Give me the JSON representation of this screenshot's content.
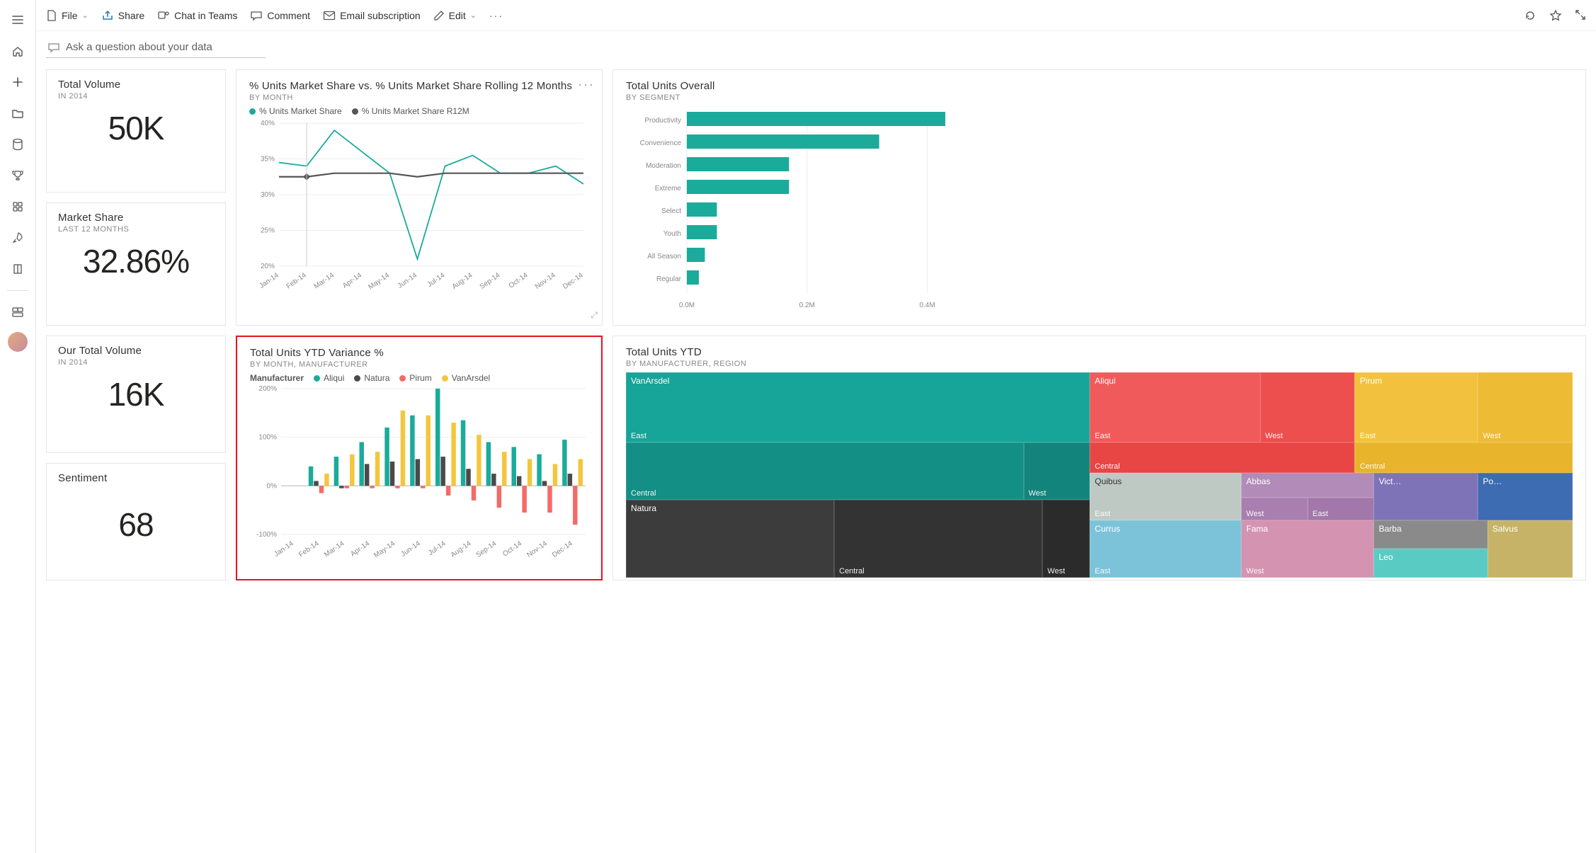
{
  "leftrail": {
    "items": [
      "menu",
      "home",
      "add",
      "folder",
      "data",
      "trophy",
      "apps",
      "rocket",
      "book"
    ],
    "more": "more"
  },
  "topbar": {
    "file": "File",
    "share": "Share",
    "chat": "Chat in Teams",
    "comment": "Comment",
    "email": "Email subscription",
    "edit": "Edit",
    "more": "···"
  },
  "qa": {
    "placeholder": "Ask a question about your data"
  },
  "kpi": {
    "totalvol": {
      "title": "Total Volume",
      "sub": "IN 2014",
      "value": "50K"
    },
    "mshare": {
      "title": "Market Share",
      "sub": "LAST 12 MONTHS",
      "value": "32.86%"
    },
    "ourvol": {
      "title": "Our Total Volume",
      "sub": "IN 2014",
      "value": "16K"
    },
    "sentiment": {
      "title": "Sentiment",
      "sub": "",
      "value": "68"
    }
  },
  "lineCard": {
    "title": "% Units Market Share vs. % Units Market Share Rolling 12 Months",
    "sub": "BY MONTH",
    "legend": [
      "% Units Market Share",
      "% Units Market Share R12M"
    ]
  },
  "segCard": {
    "title": "Total Units Overall",
    "sub": "BY SEGMENT"
  },
  "varCard": {
    "title": "Total Units YTD Variance %",
    "sub": "BY MONTH, MANUFACTURER",
    "legendLabel": "Manufacturer",
    "legend": [
      "Aliqui",
      "Natura",
      "Pirum",
      "VanArsdel"
    ]
  },
  "tmCard": {
    "title": "Total Units YTD",
    "sub": "BY MANUFACTURER, REGION"
  },
  "chart_data": [
    {
      "type": "line",
      "title": "% Units Market Share vs. % Units Market Share Rolling 12 Months",
      "categories": [
        "Jan-14",
        "Feb-14",
        "Mar-14",
        "Apr-14",
        "May-14",
        "Jun-14",
        "Jul-14",
        "Aug-14",
        "Sep-14",
        "Oct-14",
        "Nov-14",
        "Dec-14"
      ],
      "series": [
        {
          "name": "% Units Market Share",
          "color": "#1aab9b",
          "values": [
            34.5,
            34,
            39,
            36,
            33,
            21,
            34,
            35.5,
            33,
            33,
            34,
            31.5
          ]
        },
        {
          "name": "% Units Market Share R12M",
          "color": "#555555",
          "values": [
            32.5,
            32.5,
            33,
            33,
            33,
            32.5,
            33,
            33,
            33,
            33,
            33,
            33
          ]
        }
      ],
      "ylabel": "",
      "ylim": [
        20,
        40
      ],
      "yTicks": [
        20,
        25,
        30,
        35,
        40
      ]
    },
    {
      "type": "bar",
      "orientation": "horizontal",
      "title": "Total Units Overall by Segment",
      "categories": [
        "Productivity",
        "Convenience",
        "Moderation",
        "Extreme",
        "Select",
        "Youth",
        "All Season",
        "Regular"
      ],
      "values": [
        0.43,
        0.32,
        0.17,
        0.17,
        0.05,
        0.05,
        0.03,
        0.02
      ],
      "xlabel": "",
      "xlim": [
        0,
        0.45
      ],
      "xTicks": [
        0.0,
        0.2,
        0.4
      ],
      "xTickLabels": [
        "0.0M",
        "0.2M",
        "0.4M"
      ],
      "color": "#1aab9b"
    },
    {
      "type": "bar",
      "title": "Total Units YTD Variance % by Month, Manufacturer",
      "categories": [
        "Jan-14",
        "Feb-14",
        "Mar-14",
        "Apr-14",
        "May-14",
        "Jun-14",
        "Jul-14",
        "Aug-14",
        "Sep-14",
        "Oct-14",
        "Nov-14",
        "Dec-14"
      ],
      "series": [
        {
          "name": "Aliqui",
          "color": "#1aab9b",
          "values": [
            null,
            40,
            60,
            90,
            120,
            145,
            200,
            135,
            90,
            80,
            65,
            95
          ]
        },
        {
          "name": "Natura",
          "color": "#4a4a4a",
          "values": [
            null,
            10,
            -5,
            45,
            50,
            55,
            60,
            35,
            25,
            20,
            10,
            25
          ]
        },
        {
          "name": "Pirum",
          "color": "#f46a6a",
          "values": [
            null,
            -15,
            -5,
            -5,
            -5,
            -5,
            -20,
            -30,
            -45,
            -55,
            -55,
            -80
          ]
        },
        {
          "name": "VanArsdel",
          "color": "#f4c63d",
          "values": [
            null,
            25,
            65,
            70,
            155,
            145,
            130,
            105,
            70,
            55,
            45,
            55
          ]
        }
      ],
      "ylabel": "",
      "ylim": [
        -100,
        200
      ],
      "yTicks": [
        -100,
        0,
        100,
        200
      ]
    },
    {
      "type": "treemap",
      "title": "Total Units YTD by Manufacturer, Region",
      "nodes": [
        {
          "name": "VanArsdel",
          "color": "#1aab9b",
          "children": [
            {
              "name": "East",
              "size": 40
            },
            {
              "name": "Central",
              "size": 34
            },
            {
              "name": "West",
              "size": 10
            }
          ]
        },
        {
          "name": "Aliqui",
          "color": "#f46a6a",
          "children": [
            {
              "name": "East",
              "size": 12
            },
            {
              "name": "West",
              "size": 8
            },
            {
              "name": "Central",
              "size": 14
            }
          ]
        },
        {
          "name": "Pirum",
          "color": "#f4c63d",
          "children": [
            {
              "name": "East",
              "size": 8
            },
            {
              "name": "West",
              "size": 6
            },
            {
              "name": "Central",
              "size": 10
            }
          ]
        },
        {
          "name": "Natura",
          "color": "#4a4a4a",
          "children": [
            {
              "name": "Central",
              "size": 12
            },
            {
              "name": "West",
              "size": 5
            }
          ]
        },
        {
          "name": "Quibus",
          "color": "#7fb9d6",
          "children": [
            {
              "name": "East",
              "size": 7
            }
          ]
        },
        {
          "name": "Abbas",
          "color": "#b98fb9",
          "children": [
            {
              "name": "West",
              "size": 4
            },
            {
              "name": "East",
              "size": 3
            }
          ]
        },
        {
          "name": "Vict…",
          "color": "#8c7fb9",
          "children": [
            {
              "name": "",
              "size": 3
            }
          ]
        },
        {
          "name": "Po…",
          "color": "#4a7ab9",
          "children": [
            {
              "name": "",
              "size": 2
            }
          ]
        },
        {
          "name": "Currus",
          "color": "#6fc7d6",
          "children": [
            {
              "name": "East",
              "size": 5
            }
          ]
        },
        {
          "name": "Fama",
          "color": "#d68fb0",
          "children": [
            {
              "name": "West",
              "size": 4
            }
          ]
        },
        {
          "name": "Barba",
          "color": "#8f8f8f",
          "children": [
            {
              "name": "",
              "size": 4
            }
          ]
        },
        {
          "name": "Leo",
          "color": "#5fcfc0",
          "children": [
            {
              "name": "",
              "size": 3
            }
          ]
        },
        {
          "name": "Salvus",
          "color": "#c9b86f",
          "children": [
            {
              "name": "",
              "size": 3
            }
          ]
        }
      ]
    }
  ]
}
